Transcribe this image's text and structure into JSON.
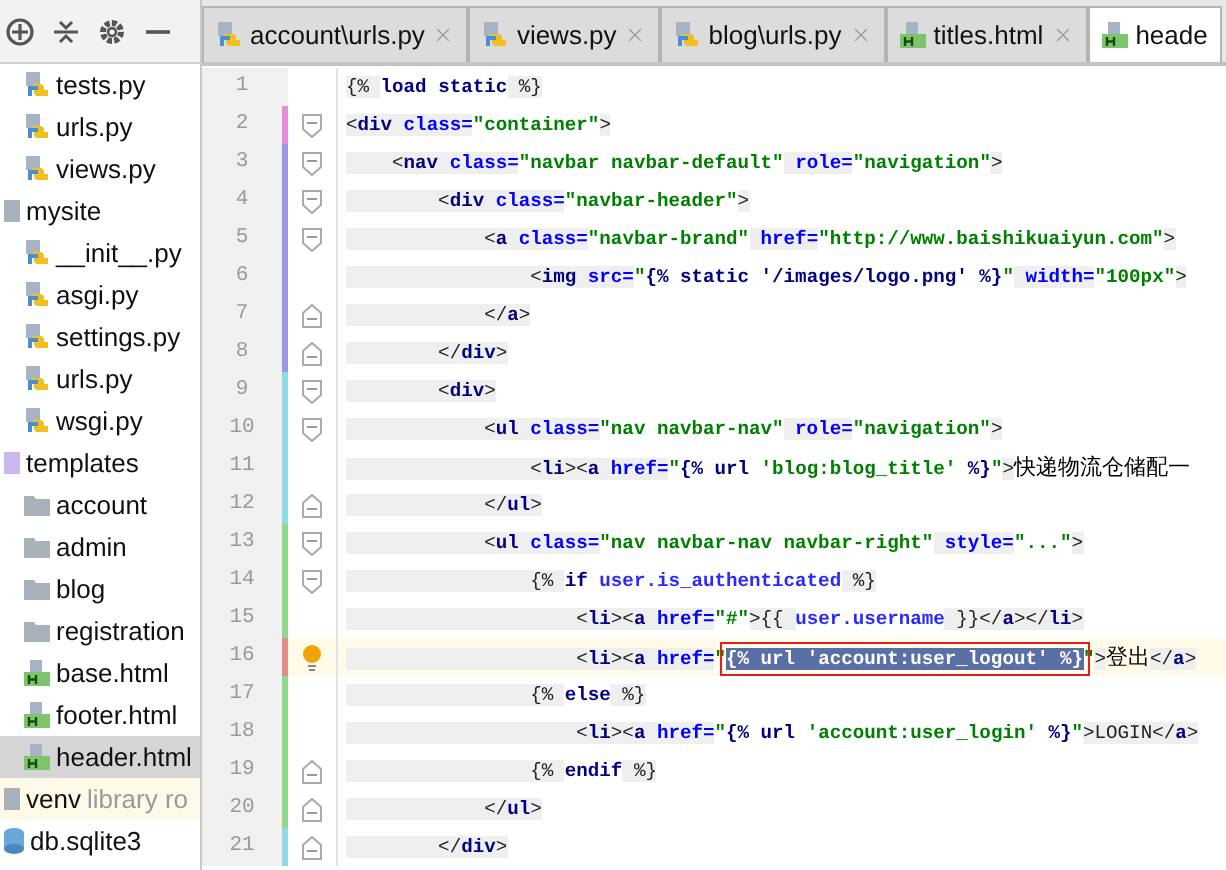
{
  "sidebar": {
    "toolbar": [
      {
        "kind": "target"
      },
      {
        "kind": "collapse"
      },
      {
        "kind": "settings"
      },
      {
        "kind": "hide"
      }
    ],
    "partial_children": [
      {
        "name": "tests.py",
        "kind": "py",
        "selected": false
      },
      {
        "name": "urls.py",
        "kind": "py",
        "selected": false
      },
      {
        "name": "views.py",
        "kind": "py",
        "selected": false
      }
    ],
    "items": [
      {
        "name": "mysite",
        "kind": "module",
        "selected": false,
        "children": [
          {
            "name": "__init__.py",
            "kind": "py",
            "selected": false
          },
          {
            "name": "asgi.py",
            "kind": "py",
            "selected": false
          },
          {
            "name": "settings.py",
            "kind": "py",
            "selected": false
          },
          {
            "name": "urls.py",
            "kind": "py",
            "selected": false
          },
          {
            "name": "wsgi.py",
            "kind": "py",
            "selected": false
          }
        ]
      },
      {
        "name": "templates",
        "kind": "templates",
        "selected": false,
        "children": [
          {
            "name": "account",
            "kind": "folder",
            "selected": false
          },
          {
            "name": "admin",
            "kind": "folder",
            "selected": false
          },
          {
            "name": "blog",
            "kind": "folder",
            "selected": false
          },
          {
            "name": "registration",
            "kind": "folder",
            "selected": false
          },
          {
            "name": "base.html",
            "kind": "html",
            "selected": false
          },
          {
            "name": "footer.html",
            "kind": "html",
            "selected": false
          },
          {
            "name": "header.html",
            "kind": "html",
            "selected": true
          }
        ]
      },
      {
        "name": "venv",
        "note": "library ro",
        "kind": "module",
        "selected": false
      },
      {
        "name": "db.sqlite3",
        "kind": "db",
        "selected": false
      }
    ]
  },
  "tabs": [
    {
      "label": "account\\urls.py",
      "kind": "py",
      "selected": false
    },
    {
      "label": "views.py",
      "kind": "py",
      "selected": false
    },
    {
      "label": "blog\\urls.py",
      "kind": "py",
      "selected": false
    },
    {
      "label": "titles.html",
      "kind": "html",
      "selected": false
    },
    {
      "label": "heade",
      "kind": "html",
      "selected": true
    }
  ],
  "editor": {
    "lines": [
      {
        "number": "1",
        "current": false,
        "color": "#f0f0f0",
        "tokens": [
          {
            "kind": "p",
            "t": "{% "
          },
          {
            "kind": "tpl",
            "t": "load static"
          },
          {
            "kind": "p",
            "t": " %}"
          }
        ]
      },
      {
        "number": "2",
        "fold": {
          "kind": "open"
        },
        "current": false,
        "color": "#e58ce0",
        "tokens": [
          {
            "kind": "p",
            "t": "<"
          },
          {
            "kind": "tag",
            "t": "div"
          },
          {
            "kind": "attr",
            "t": " class="
          },
          {
            "kind": "str",
            "t": "\"container\""
          },
          {
            "kind": "p",
            "t": ">"
          }
        ]
      },
      {
        "number": "3",
        "fold": {
          "kind": "open"
        },
        "current": false,
        "color": "#9b97e0",
        "tokens": [
          {
            "kind": "p",
            "t": "    <"
          },
          {
            "kind": "tag",
            "t": "nav"
          },
          {
            "kind": "attr",
            "t": " class="
          },
          {
            "kind": "str",
            "t": "\"navbar navbar-default\""
          },
          {
            "kind": "attr",
            "t": " role="
          },
          {
            "kind": "str",
            "t": "\"navigation\""
          },
          {
            "kind": "p",
            "t": ">"
          }
        ]
      },
      {
        "number": "4",
        "fold": {
          "kind": "open"
        },
        "current": false,
        "color": "#9b97e0",
        "tokens": [
          {
            "kind": "p",
            "t": "        <"
          },
          {
            "kind": "tag",
            "t": "div"
          },
          {
            "kind": "attr",
            "t": " class="
          },
          {
            "kind": "str",
            "t": "\"navbar-header\""
          },
          {
            "kind": "p",
            "t": ">"
          }
        ]
      },
      {
        "number": "5",
        "fold": {
          "kind": "open"
        },
        "current": false,
        "color": "#9b97e0",
        "tokens": [
          {
            "kind": "p",
            "t": "            <"
          },
          {
            "kind": "tag",
            "t": "a"
          },
          {
            "kind": "attr",
            "t": " class="
          },
          {
            "kind": "str",
            "t": "\"navbar-brand\""
          },
          {
            "kind": "attr",
            "t": " href="
          },
          {
            "kind": "str",
            "t": "\"http://www.baishikuaiyun.com\""
          },
          {
            "kind": "p",
            "t": ">"
          }
        ]
      },
      {
        "number": "6",
        "current": false,
        "color": "#9b97e0",
        "tokens": [
          {
            "kind": "p",
            "t": "                <"
          },
          {
            "kind": "tag",
            "t": "img"
          },
          {
            "kind": "attr",
            "t": " src="
          },
          {
            "kind": "str",
            "t": "\""
          },
          {
            "kind": "tpl",
            "t": "{% static '/images/logo.png' %}"
          },
          {
            "kind": "str",
            "t": "\""
          },
          {
            "kind": "attr",
            "t": " width="
          },
          {
            "kind": "str",
            "t": "\"100px\""
          },
          {
            "kind": "p",
            "t": ">"
          }
        ]
      },
      {
        "number": "7",
        "fold": {
          "kind": "close"
        },
        "current": false,
        "color": "#9b97e0",
        "tokens": [
          {
            "kind": "p",
            "t": "            </"
          },
          {
            "kind": "tag",
            "t": "a"
          },
          {
            "kind": "p",
            "t": ">"
          }
        ]
      },
      {
        "number": "8",
        "fold": {
          "kind": "close"
        },
        "current": false,
        "color": "#9b97e0",
        "tokens": [
          {
            "kind": "p",
            "t": "        </"
          },
          {
            "kind": "tag",
            "t": "div"
          },
          {
            "kind": "p",
            "t": ">"
          }
        ]
      },
      {
        "number": "9",
        "fold": {
          "kind": "open"
        },
        "current": false,
        "color": "#8fdbe0",
        "tokens": [
          {
            "kind": "p",
            "t": "        <"
          },
          {
            "kind": "tag",
            "t": "div"
          },
          {
            "kind": "p",
            "t": ">"
          }
        ]
      },
      {
        "number": "10",
        "fold": {
          "kind": "open"
        },
        "current": false,
        "color": "#8fdbe0",
        "tokens": [
          {
            "kind": "p",
            "t": "            <"
          },
          {
            "kind": "tag",
            "t": "ul"
          },
          {
            "kind": "attr",
            "t": " class="
          },
          {
            "kind": "str",
            "t": "\"nav navbar-nav\""
          },
          {
            "kind": "attr",
            "t": " role="
          },
          {
            "kind": "str",
            "t": "\"navigation\""
          },
          {
            "kind": "p",
            "t": ">"
          }
        ]
      },
      {
        "number": "11",
        "current": false,
        "color": "#8fdbe0",
        "tokens": [
          {
            "kind": "p",
            "t": "                <"
          },
          {
            "kind": "tag",
            "t": "li"
          },
          {
            "kind": "p",
            "t": "><"
          },
          {
            "kind": "tag",
            "t": "a"
          },
          {
            "kind": "attr",
            "t": " href="
          },
          {
            "kind": "str",
            "t": "\""
          },
          {
            "kind": "tpl",
            "t": "{% url "
          },
          {
            "kind": "str",
            "t": "'blog:blog_title'"
          },
          {
            "kind": "tpl",
            "t": " %}"
          },
          {
            "kind": "str",
            "t": "\""
          },
          {
            "kind": "p",
            "t": ">"
          },
          {
            "kind": "cn",
            "t": "快递物流仓储配一"
          }
        ]
      },
      {
        "number": "12",
        "fold": {
          "kind": "close"
        },
        "current": false,
        "color": "#8fdbe0",
        "tokens": [
          {
            "kind": "p",
            "t": "            </"
          },
          {
            "kind": "tag",
            "t": "ul"
          },
          {
            "kind": "p",
            "t": ">"
          }
        ]
      },
      {
        "number": "13",
        "fold": {
          "kind": "open"
        },
        "current": false,
        "color": "#92d88c",
        "tokens": [
          {
            "kind": "p",
            "t": "            <"
          },
          {
            "kind": "tag",
            "t": "ul"
          },
          {
            "kind": "attr",
            "t": " class="
          },
          {
            "kind": "str",
            "t": "\"nav navbar-nav navbar-right\""
          },
          {
            "kind": "attr",
            "t": " style="
          },
          {
            "kind": "str",
            "t": "\"...\""
          },
          {
            "kind": "p",
            "t": ">"
          }
        ]
      },
      {
        "number": "14",
        "fold": {
          "kind": "open"
        },
        "current": false,
        "color": "#92d88c",
        "tokens": [
          {
            "kind": "p",
            "t": "                {% "
          },
          {
            "kind": "tpl",
            "t": "if "
          },
          {
            "kind": "var",
            "t": "user.is_authenticated"
          },
          {
            "kind": "p",
            "t": " %}"
          }
        ]
      },
      {
        "number": "15",
        "current": false,
        "color": "#92d88c",
        "tokens": [
          {
            "kind": "p",
            "t": "                    <"
          },
          {
            "kind": "tag",
            "t": "li"
          },
          {
            "kind": "p",
            "t": "><"
          },
          {
            "kind": "tag",
            "t": "a"
          },
          {
            "kind": "attr",
            "t": " href="
          },
          {
            "kind": "str",
            "t": "\"#\""
          },
          {
            "kind": "p",
            "t": ">{{ "
          },
          {
            "kind": "var",
            "t": "user.username"
          },
          {
            "kind": "p",
            "t": " }}</"
          },
          {
            "kind": "tag",
            "t": "a"
          },
          {
            "kind": "p",
            "t": "></"
          },
          {
            "kind": "tag",
            "t": "li"
          },
          {
            "kind": "p",
            "t": ">"
          }
        ]
      },
      {
        "number": "16",
        "current": true,
        "color": "#e08c8c",
        "tokens": [
          {
            "kind": "p",
            "t": "                    <"
          },
          {
            "kind": "tag",
            "t": "li"
          },
          {
            "kind": "p",
            "t": "><"
          },
          {
            "kind": "tag",
            "t": "a"
          },
          {
            "kind": "attr",
            "t": " href="
          },
          {
            "kind": "str",
            "t": "\""
          },
          {
            "kind": "sel",
            "t": "{% url 'account:user_logout' %}"
          },
          {
            "kind": "str",
            "t": "\""
          },
          {
            "kind": "p",
            "t": ">"
          },
          {
            "kind": "cn",
            "t": "登出"
          },
          {
            "kind": "p",
            "t": "</"
          },
          {
            "kind": "tag",
            "t": "a"
          },
          {
            "kind": "p",
            "t": ">"
          }
        ]
      },
      {
        "number": "17",
        "current": false,
        "color": "#92d88c",
        "tokens": [
          {
            "kind": "p",
            "t": "                {% "
          },
          {
            "kind": "tpl",
            "t": "else"
          },
          {
            "kind": "p",
            "t": " %}"
          }
        ]
      },
      {
        "number": "18",
        "current": false,
        "color": "#92d88c",
        "tokens": [
          {
            "kind": "p",
            "t": "                    <"
          },
          {
            "kind": "tag",
            "t": "li"
          },
          {
            "kind": "p",
            "t": "><"
          },
          {
            "kind": "tag",
            "t": "a"
          },
          {
            "kind": "attr",
            "t": " href="
          },
          {
            "kind": "str",
            "t": "\""
          },
          {
            "kind": "tpl",
            "t": "{% url "
          },
          {
            "kind": "str",
            "t": "'account:user_login'"
          },
          {
            "kind": "tpl",
            "t": " %}"
          },
          {
            "kind": "str",
            "t": "\""
          },
          {
            "kind": "p",
            "t": ">LOGIN</"
          },
          {
            "kind": "tag",
            "t": "a"
          },
          {
            "kind": "p",
            "t": ">"
          }
        ]
      },
      {
        "number": "19",
        "fold": {
          "kind": "close"
        },
        "current": false,
        "color": "#92d88c",
        "tokens": [
          {
            "kind": "p",
            "t": "                {% "
          },
          {
            "kind": "tpl",
            "t": "endif"
          },
          {
            "kind": "p",
            "t": " %}"
          }
        ]
      },
      {
        "number": "20",
        "fold": {
          "kind": "close"
        },
        "current": false,
        "color": "#92d88c",
        "tokens": [
          {
            "kind": "p",
            "t": "            </"
          },
          {
            "kind": "tag",
            "t": "ul"
          },
          {
            "kind": "p",
            "t": ">"
          }
        ]
      },
      {
        "number": "21",
        "fold": {
          "kind": "close"
        },
        "current": false,
        "color": "#8fdbe0",
        "tokens": [
          {
            "kind": "p",
            "t": "        </"
          },
          {
            "kind": "tag",
            "t": "div"
          },
          {
            "kind": "p",
            "t": ">"
          }
        ]
      }
    ]
  }
}
